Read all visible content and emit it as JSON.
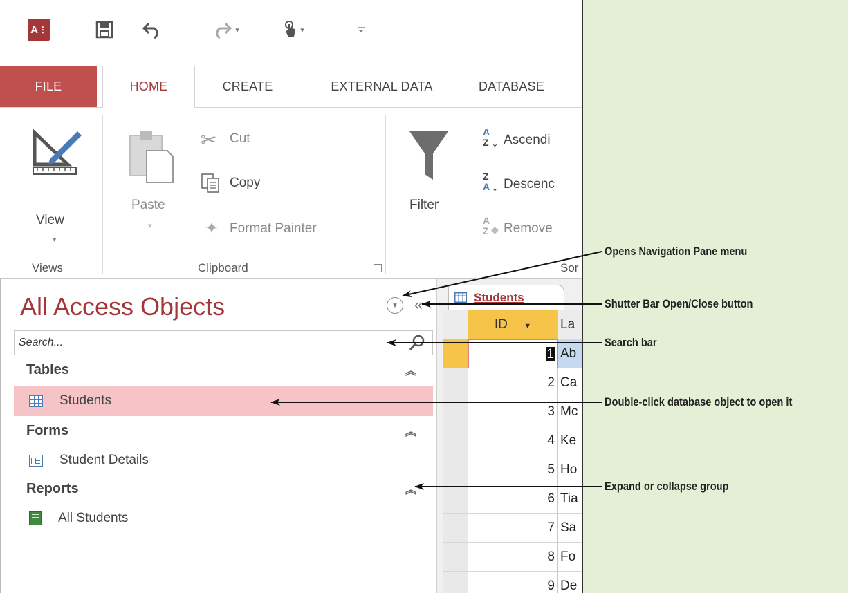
{
  "quick_access": {
    "app_logo": "A",
    "icons": [
      "access-logo-icon",
      "save-icon",
      "undo-icon",
      "redo-icon",
      "touch-mode-icon",
      "customize-qat-icon"
    ]
  },
  "ribbon_tabs": [
    "FILE",
    "HOME",
    "CREATE",
    "EXTERNAL DATA",
    "DATABASE"
  ],
  "ribbon": {
    "views": {
      "view_label": "View",
      "group_label": "Views"
    },
    "clipboard": {
      "paste_label": "Paste",
      "cut_label": "Cut",
      "copy_label": "Copy",
      "format_painter_label": "Format Painter",
      "group_label": "Clipboard"
    },
    "sort_filter": {
      "filter_label": "Filter",
      "ascending_label": "Ascendi",
      "descending_label": "Descenc",
      "remove_label": "Remove",
      "group_label": "Sor"
    }
  },
  "nav_pane": {
    "title": "All Access Objects",
    "search_placeholder": "Search...",
    "groups": [
      {
        "label": "Tables",
        "items": [
          {
            "label": "Students",
            "icon": "table-icon",
            "selected": true
          }
        ]
      },
      {
        "label": "Forms",
        "items": [
          {
            "label": "Student Details",
            "icon": "form-icon",
            "selected": false
          }
        ]
      },
      {
        "label": "Reports",
        "items": [
          {
            "label": "All Students",
            "icon": "report-icon",
            "selected": false
          }
        ]
      }
    ]
  },
  "datasheet": {
    "tab_label": "Students",
    "columns": [
      "ID",
      "La"
    ],
    "rows": [
      {
        "id": "1",
        "last": "Ab"
      },
      {
        "id": "2",
        "last": "Ca"
      },
      {
        "id": "3",
        "last": "Mc"
      },
      {
        "id": "4",
        "last": "Ke"
      },
      {
        "id": "5",
        "last": "Ho"
      },
      {
        "id": "6",
        "last": "Tia"
      },
      {
        "id": "7",
        "last": "Sa"
      },
      {
        "id": "8",
        "last": "Fo"
      },
      {
        "id": "9",
        "last": "De"
      }
    ]
  },
  "callouts": {
    "nav_menu": "Opens Navigation Pane menu",
    "shutter": "Shutter Bar Open/Close button",
    "search": "Search bar",
    "open_object": "Double-click database object to open it",
    "expand_group": "Expand or collapse group"
  },
  "colors": {
    "background": "#e4efd6",
    "access_red": "#a4373a",
    "file_tab": "#c0504d",
    "selected_item": "#f6c3c6",
    "current_record": "#f7c44a"
  }
}
